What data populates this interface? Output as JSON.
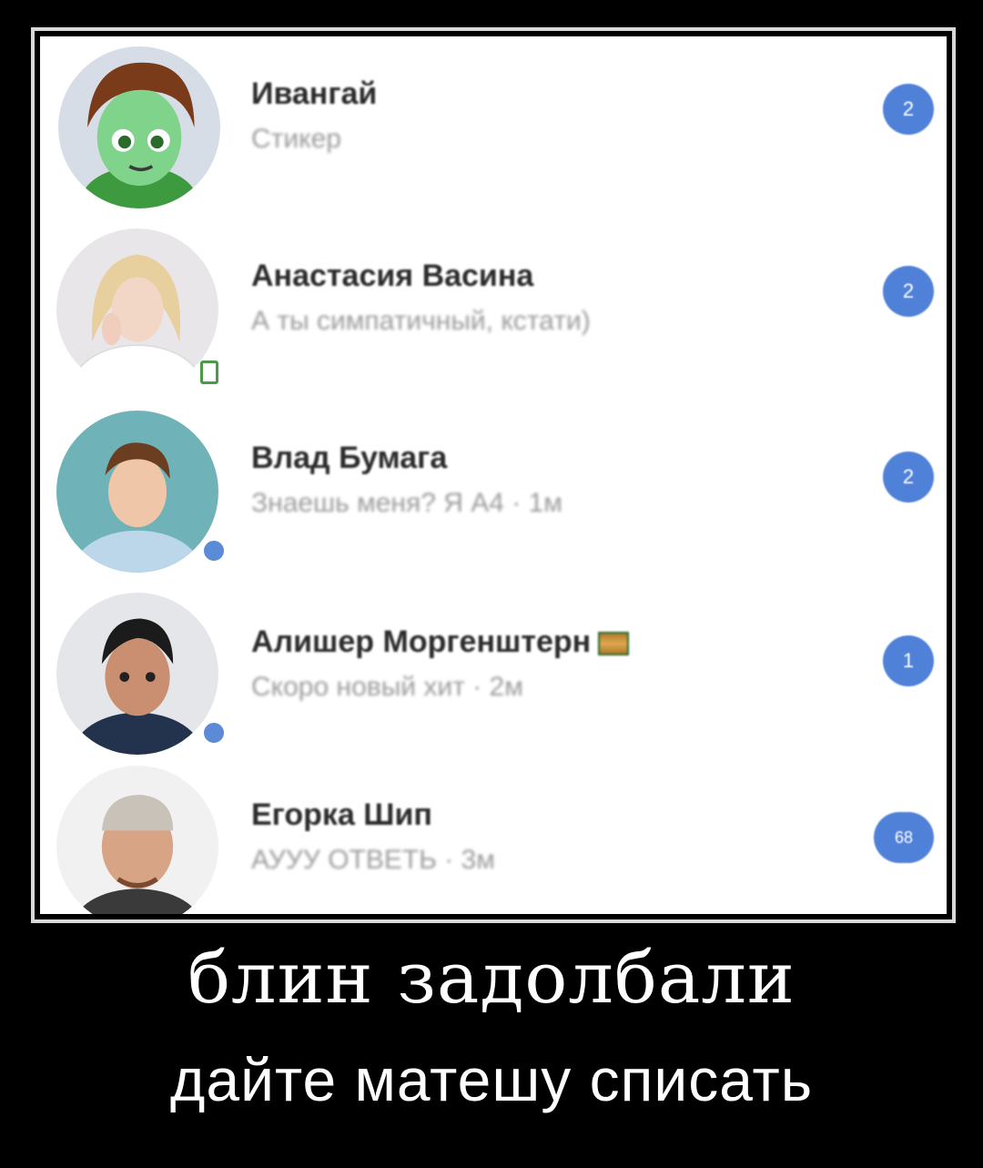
{
  "dialogs": [
    {
      "name": "Ивангай",
      "message": "Стикер",
      "unread": "2"
    },
    {
      "name": "Анастасия Васина",
      "message": "А ты симпатичный, кстати)",
      "unread": "2"
    },
    {
      "name": "Влад Бумага",
      "message": "Знаешь меня? Я А4 · 1м",
      "unread": "2"
    },
    {
      "name": "Алишер Моргенштерн",
      "message": "Скоро новый хит · 2м",
      "unread": "1"
    },
    {
      "name": "Егорка Шип",
      "message": "АУУУ ОТВЕТЬ · 3м",
      "unread": "68"
    }
  ],
  "caption": {
    "line1": "блин задолбали",
    "line2": "дайте матешу списать"
  },
  "colors": {
    "badge": "#4f81d8",
    "background": "#000000",
    "panel": "#ffffff"
  }
}
